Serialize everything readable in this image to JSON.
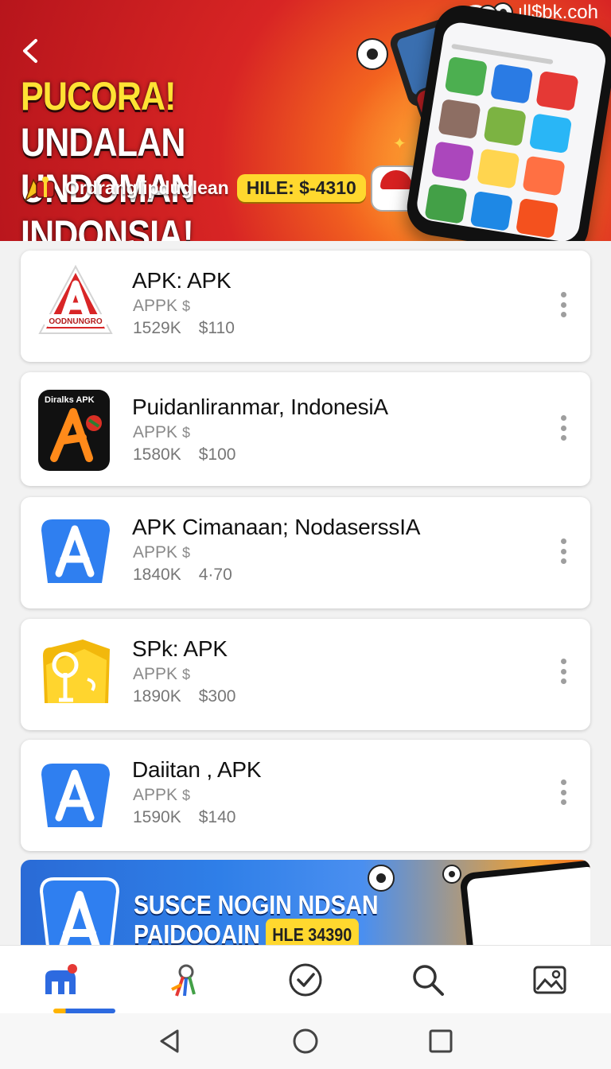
{
  "status_bar": {
    "text": "ıll$bk.coh"
  },
  "hero": {
    "title_line1_accent": "PUCORA!",
    "title_line1_rest": " UNDALAN",
    "title_line2": "UNDOMAN INDONSIA!",
    "subtitle": "Ordranglipduglean",
    "badge": "HILE: $-4310"
  },
  "apps": [
    {
      "title": "APK: APK",
      "subtitle": "APPK",
      "sub_symbol": "$",
      "downloads": "1529K",
      "price": "$110",
      "icon": "red-triangle-a-icon",
      "icon_label": "OODNUNGRO"
    },
    {
      "title": "Puidanliranmar, IndonesiA",
      "subtitle": "APPK",
      "sub_symbol": "$",
      "downloads": "1580K",
      "price": "$100",
      "icon": "black-orange-a-icon",
      "icon_label": "Diralks APK"
    },
    {
      "title": "APK Cimanaan; NodaserssIA",
      "subtitle": "APPK",
      "sub_symbol": "$",
      "downloads": "1840K",
      "price": "4·70",
      "icon": "blue-a-icon"
    },
    {
      "title": "SPk: APK",
      "subtitle": "APPK",
      "sub_symbol": "$",
      "downloads": "1890K",
      "price": "$300",
      "icon": "yellow-folder-icon"
    },
    {
      "title": "Daiitan , APK",
      "subtitle": "APPK",
      "sub_symbol": "$",
      "downloads": "1590K",
      "price": "$140",
      "icon": "blue-a-icon"
    }
  ],
  "promo": {
    "line1": "SUSCE NOGIN NDSAN",
    "line2": "PAIDOOAIN",
    "badge": "HLE 34390"
  },
  "bottom_nav": [
    "home-icon",
    "apps-icon",
    "check-icon",
    "search-icon",
    "gallery-icon"
  ],
  "colors": {
    "hero_red": "#d82524",
    "accent_yellow": "#ffd82e",
    "nav_blue": "#2d6ae0"
  }
}
